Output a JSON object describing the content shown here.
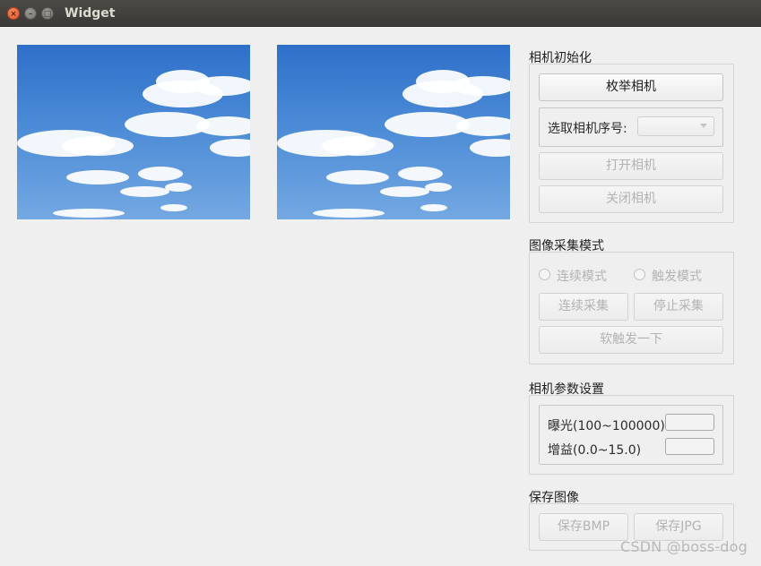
{
  "window": {
    "title": "Widget"
  },
  "camera_init": {
    "title": "相机初始化",
    "enumerate_label": "枚举相机",
    "select_label": "选取相机序号:",
    "open_label": "打开相机",
    "close_label": "关闭相机"
  },
  "acquisition": {
    "title": "图像采集模式",
    "continuous_mode_label": "连续模式",
    "trigger_mode_label": "触发模式",
    "continuous_capture_label": "连续采集",
    "stop_capture_label": "停止采集",
    "soft_trigger_label": "软触发一下"
  },
  "params": {
    "title": "相机参数设置",
    "exposure_label": "曝光(100~100000)",
    "gain_label": "增益(0.0~15.0)"
  },
  "save": {
    "title": "保存图像",
    "bmp_label": "保存BMP",
    "jpg_label": "保存JPG"
  },
  "watermark": "CSDN @boss-dog"
}
